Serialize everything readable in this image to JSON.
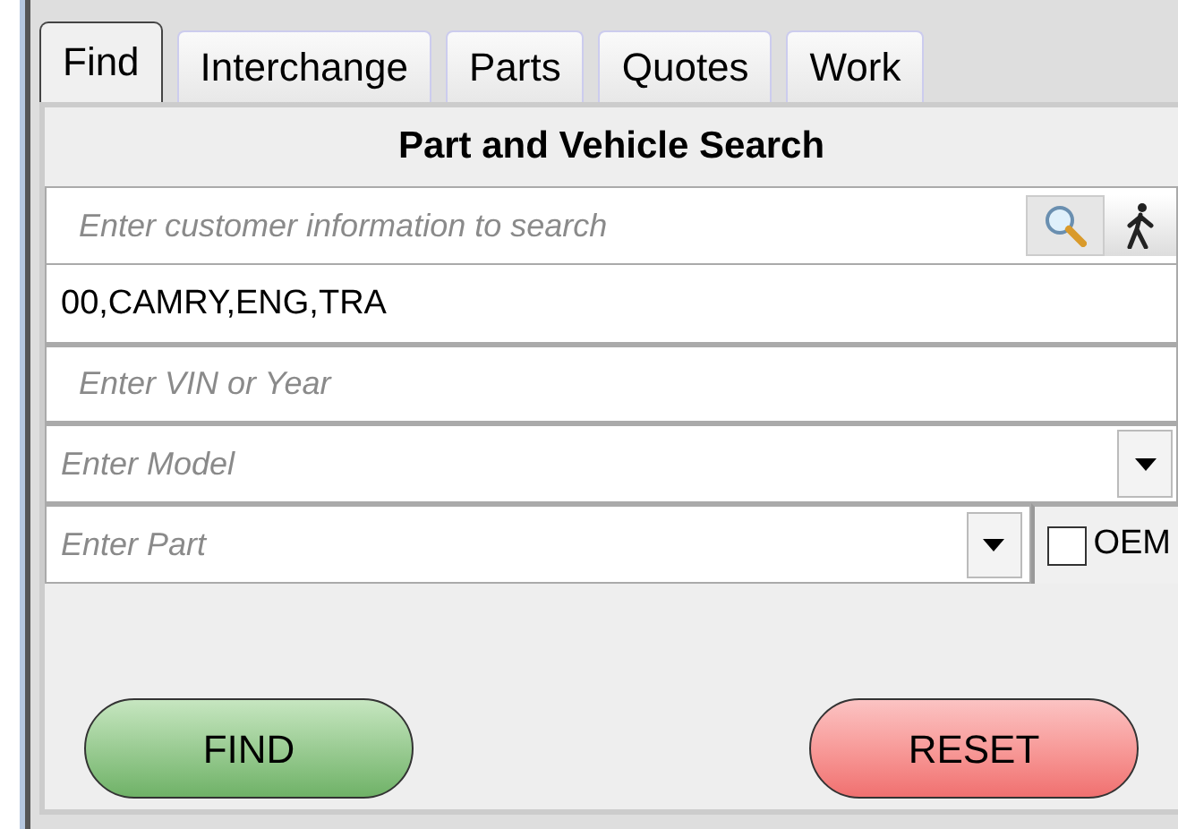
{
  "tabs": [
    {
      "label": "Find",
      "selected": true
    },
    {
      "label": "Interchange",
      "selected": false
    },
    {
      "label": "Parts",
      "selected": false
    },
    {
      "label": "Quotes",
      "selected": false
    },
    {
      "label": "Work",
      "selected": false
    }
  ],
  "panel_title": "Part and Vehicle Search",
  "customer_search": {
    "placeholder": "Enter customer information to search"
  },
  "query": {
    "value": "00,CAMRY,ENG,TRA"
  },
  "vin": {
    "placeholder": "Enter VIN or Year"
  },
  "model": {
    "placeholder": "Enter Model"
  },
  "part": {
    "placeholder": "Enter Part"
  },
  "oem": {
    "label": "OEM",
    "checked": false
  },
  "buttons": [
    {
      "label": "FIND",
      "kind": "go"
    },
    {
      "label": "RESET",
      "kind": "reset"
    }
  ]
}
